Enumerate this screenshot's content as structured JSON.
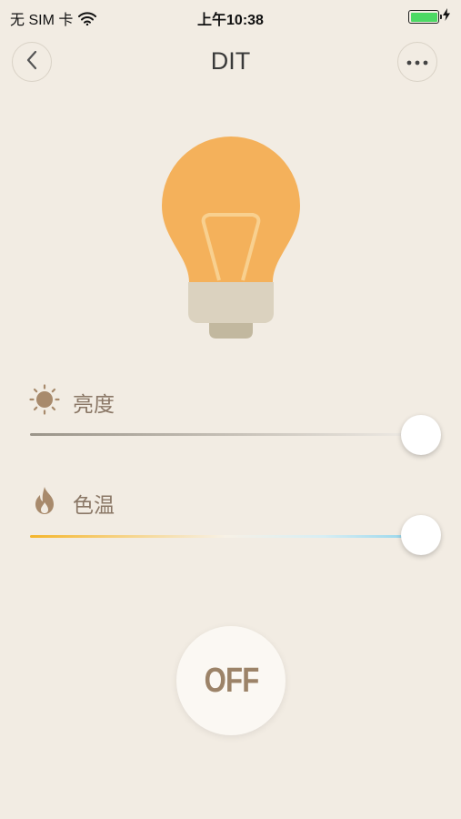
{
  "status_bar": {
    "carrier": "无 SIM 卡",
    "time": "上午10:38",
    "icons": [
      "wifi-icon",
      "battery-icon",
      "charging-icon"
    ],
    "battery_level": 1.0,
    "battery_color": "#4cd964"
  },
  "nav": {
    "title": "DIT",
    "back_icon": "chevron-left-icon",
    "more_icon": "more-icon"
  },
  "bulb": {
    "icon": "light-bulb-icon",
    "color": "#f4b15b",
    "base_color": "#dbd2bf"
  },
  "brightness": {
    "label": "亮度",
    "icon": "sun-icon",
    "value": 1.0
  },
  "color_temperature": {
    "label": "色温",
    "icon": "flame-icon",
    "value": 1.0
  },
  "power": {
    "label": "OFF",
    "text_color": "#9c8368"
  }
}
